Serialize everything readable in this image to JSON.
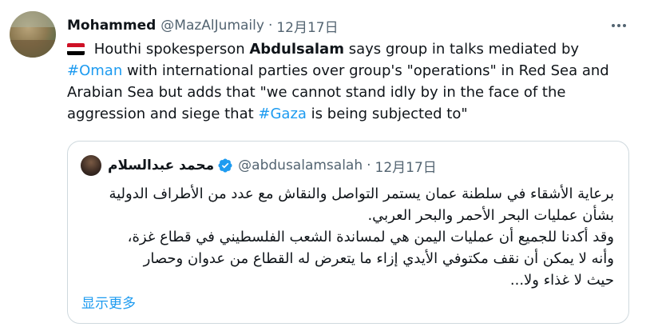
{
  "tweet": {
    "author_name": "Mohammed",
    "author_handle": "@MazAlJumaily",
    "separator": "·",
    "date": "12月17日",
    "text_1": " Houthi spokesperson ",
    "text_bold": "Abdulsalam",
    "text_2": " says group in talks mediated by ",
    "hashtag_oman": "#Oman",
    "text_3": " with international parties over group's \"operations\" in Red Sea and Arabian Sea but adds that \"we cannot stand idly by in the face of the aggression and siege that ",
    "hashtag_gaza": "#Gaza",
    "text_4": " is being subjected to\"",
    "flag_icon": "yemen-flag-icon",
    "more_icon": "more-options-icon"
  },
  "quoted_tweet": {
    "author_name": "محمد عبدالسلام",
    "author_handle": "@abdusalamsalah",
    "separator": "·",
    "date": "12月17日",
    "text": "برعاية الأشقاء في سلطنة عمان يستمر التواصل والنقاش مع عدد من الأطراف الدولية بشأن عمليات البحر الأحمر والبحر العربي.\nوقد أكدنا للجميع أن عمليات اليمن هي لمساندة الشعب الفلسطيني في قطاع غزة،\nوأنه لا يمكن أن نقف مكتوفي الأيدي إزاء ما يتعرض له القطاع من عدوان وحصار\nحيث لا غذاء ولا...",
    "show_more_label": "显示更多",
    "verified_icon": "verified-badge-icon"
  },
  "colors": {
    "link": "#1d9bf0",
    "secondary_text": "#536471",
    "border": "#cfd9de"
  }
}
